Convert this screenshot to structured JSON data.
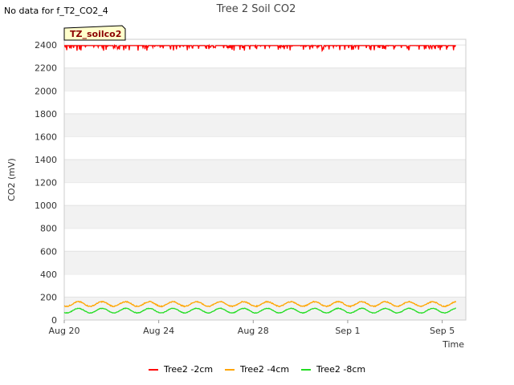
{
  "notice": "No data for f_T2_CO2_4",
  "chart_data": {
    "type": "line",
    "title": "Tree 2 Soil CO2",
    "xlabel": "Time",
    "ylabel": "CO2 (mV)",
    "tag": "TZ_soilco2",
    "ylim": [
      0,
      2450
    ],
    "yticks": [
      0,
      200,
      400,
      600,
      800,
      1000,
      1200,
      1400,
      1600,
      1800,
      2000,
      2200,
      2400
    ],
    "xlim": [
      "2023-08-20",
      "2023-09-06"
    ],
    "xticks": [
      {
        "label": "Aug 20",
        "day": 0
      },
      {
        "label": "Aug 24",
        "day": 4
      },
      {
        "label": "Aug 28",
        "day": 8
      },
      {
        "label": "Sep 1",
        "day": 12
      },
      {
        "label": "Sep 5",
        "day": 16
      }
    ],
    "x_start": "2023-08-20",
    "x_end": "2023-09-05 14:00",
    "grid": "horizontal bands",
    "series": [
      {
        "name": "Tree2 -2cm",
        "color": "#ff0000",
        "baseline": 2395,
        "amplitude": 15,
        "noise": 45
      },
      {
        "name": "Tree2 -4cm",
        "color": "#ffa500",
        "baseline": 140,
        "amplitude": 20,
        "noise": 8
      },
      {
        "name": "Tree2 -8cm",
        "color": "#22dd22",
        "baseline": 82,
        "amplitude": 20,
        "noise": 5
      }
    ]
  }
}
